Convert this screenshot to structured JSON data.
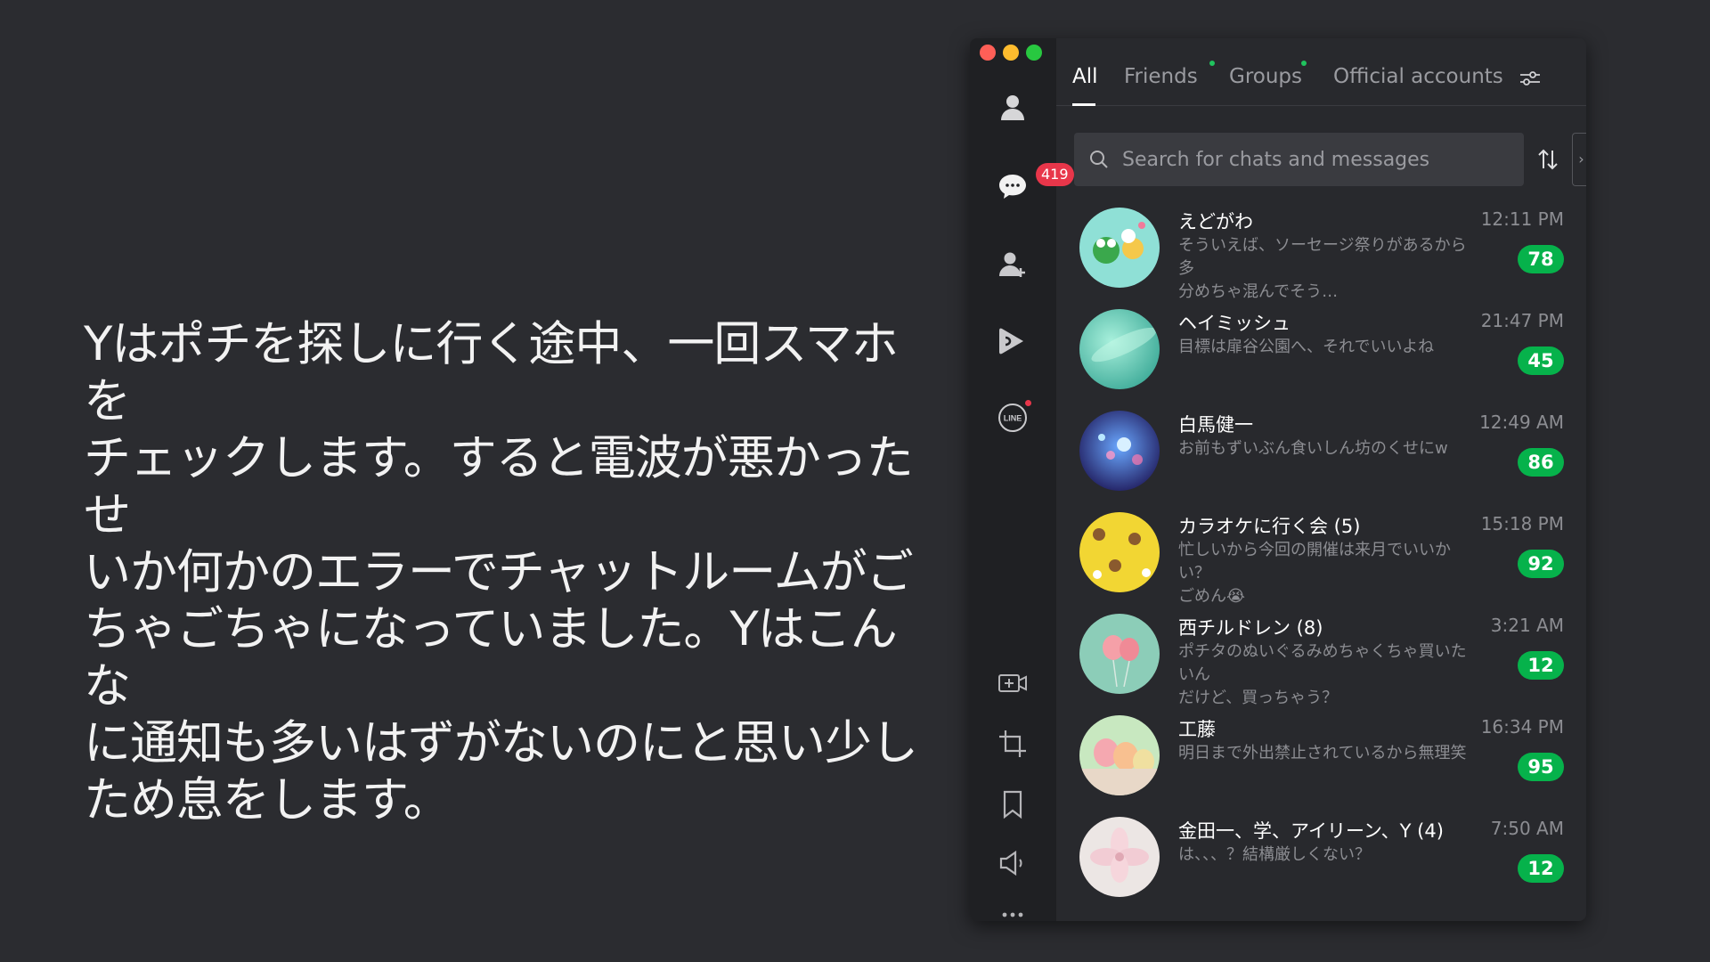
{
  "narration": {
    "text": "Yはポチを探しに行く途中、一回スマホを\nチェックします。すると電波が悪かったせ\nいか何かのエラーでチャットルームがご\nちゃごちゃになっていました。Yはこんな\nに通知も多いはずがないのにと思い少し\nため息をします。"
  },
  "sidebar": {
    "chat_badge": "419",
    "line_label": "LINE"
  },
  "tabs": [
    {
      "label": "All"
    },
    {
      "label": "Friends"
    },
    {
      "label": "Groups"
    },
    {
      "label": "Official accounts"
    }
  ],
  "search": {
    "placeholder": "Search for chats and messages"
  },
  "chats": [
    {
      "name": "えどがわ",
      "preview": "そういえば、ソーセージ祭りがあるから多\n分めちゃ混んでそう…",
      "time": "12:11 PM",
      "count": "78"
    },
    {
      "name": "ヘイミッシュ",
      "preview": "目標は扉谷公園へ、それでいいよね",
      "time": "21:47 PM",
      "count": "45"
    },
    {
      "name": "白馬健一",
      "preview": "お前もずいぶん食いしん坊のくせにw",
      "time": "12:49 AM",
      "count": "86"
    },
    {
      "name": "カラオケに行く会 (5)",
      "preview": "忙しいから今回の開催は来月でいいかい？\nごめん😭",
      "time": "15:18 PM",
      "count": "92"
    },
    {
      "name": "西チルドレン (8)",
      "preview": "ポチタのぬいぐるみめちゃくちゃ買いたいん\nだけど、買っちゃう？",
      "time": "3:21 AM",
      "count": "12"
    },
    {
      "name": "工藤",
      "preview": "明日まで外出禁止されているから無理笑",
      "time": "16:34 PM",
      "count": "95"
    },
    {
      "name": "金田一、学、アイリーン、Y (4)",
      "preview": "は、、、？結構厳しくない？",
      "time": "7:50 AM",
      "count": "12"
    }
  ]
}
